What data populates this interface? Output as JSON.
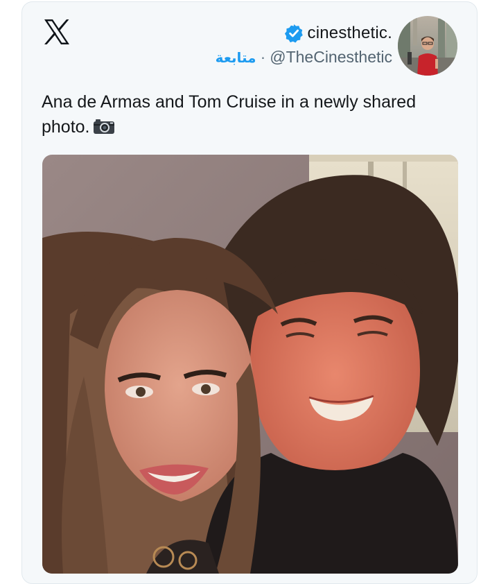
{
  "tweet": {
    "display_name": "cinesthetic.",
    "handle": "@TheCinesthetic",
    "follow_label": "متابعة",
    "separator": "·",
    "text": "Ana de Armas and Tom Cruise in a newly shared photo."
  },
  "icons": {
    "logo": "x-logo-icon",
    "verified": "verified-badge-icon",
    "emoji": "camera-emoji-icon"
  },
  "colors": {
    "link": "#1d9bf0",
    "verified": "#1d9bf0",
    "card_bg": "#f5f8fa",
    "text": "#14171a",
    "secondary_text": "#536471"
  }
}
